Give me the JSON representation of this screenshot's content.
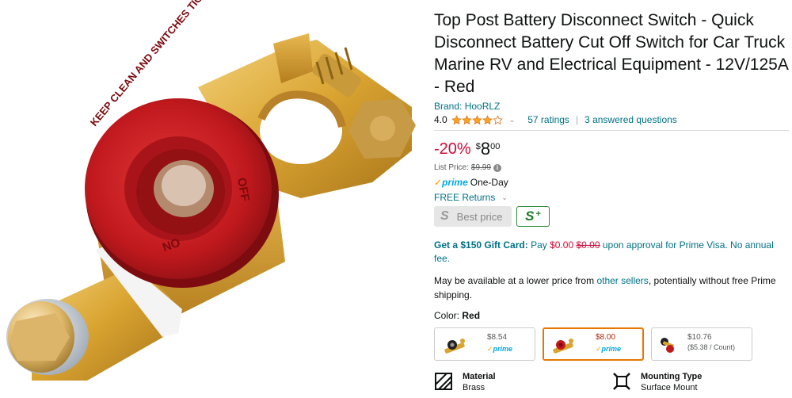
{
  "product": {
    "title": "Top Post Battery Disconnect Switch - Quick Disconnect Battery Cut Off Switch for Car Truck Marine RV and Electrical Equipment - 12V/125A - Red",
    "brand": "Brand: HooRLZ",
    "rating_value": "4.0",
    "rating_stars": 4,
    "ratings_count": "57 ratings",
    "answered_questions": "3 answered questions"
  },
  "image": {
    "knob_text_top": "KEEP CLEAN AND SWITCHES TIGHT",
    "knob_off": "OFF",
    "knob_on": "ON"
  },
  "pricing": {
    "discount": "-20%",
    "currency": "$",
    "whole": "8",
    "fraction": "00",
    "list_price_label": "List Price:",
    "list_price": "$9.99",
    "prime_label": "prime",
    "prime_delivery": "One-Day",
    "free_returns": "FREE Returns",
    "best_price_badge": "Best price",
    "best_price_letter": "S",
    "splus_letter": "S",
    "splus_plus": "+"
  },
  "gift": {
    "lead": "Get a $150 Gift Card:",
    "pay": "Pay",
    "pay_price": "$0.00",
    "old_price": "$0.00",
    "rest": "upon approval for Prime Visa. No annual fee."
  },
  "lower_price": {
    "text_a": "May be available at a lower price from",
    "link": "other sellers",
    "text_b": ", potentially without free Prime shipping."
  },
  "color": {
    "label": "Color:",
    "value": "Red",
    "swatches": [
      {
        "price": "$8.54",
        "prime": "prime",
        "unit": ""
      },
      {
        "price": "$8.00",
        "prime": "prime",
        "unit": ""
      },
      {
        "price": "$10.76",
        "prime": "",
        "unit": "($5.38 / Count)"
      }
    ]
  },
  "attributes": [
    {
      "label": "Material",
      "value": "Brass"
    },
    {
      "label": "Mounting Type",
      "value": "Surface Mount"
    }
  ],
  "colors": {
    "link": "#007185",
    "discount": "#cc0c39",
    "prime": "#00a8e1",
    "selected_border": "#e77600",
    "knob_red": "#c0191d",
    "brass": "#d9a330"
  }
}
